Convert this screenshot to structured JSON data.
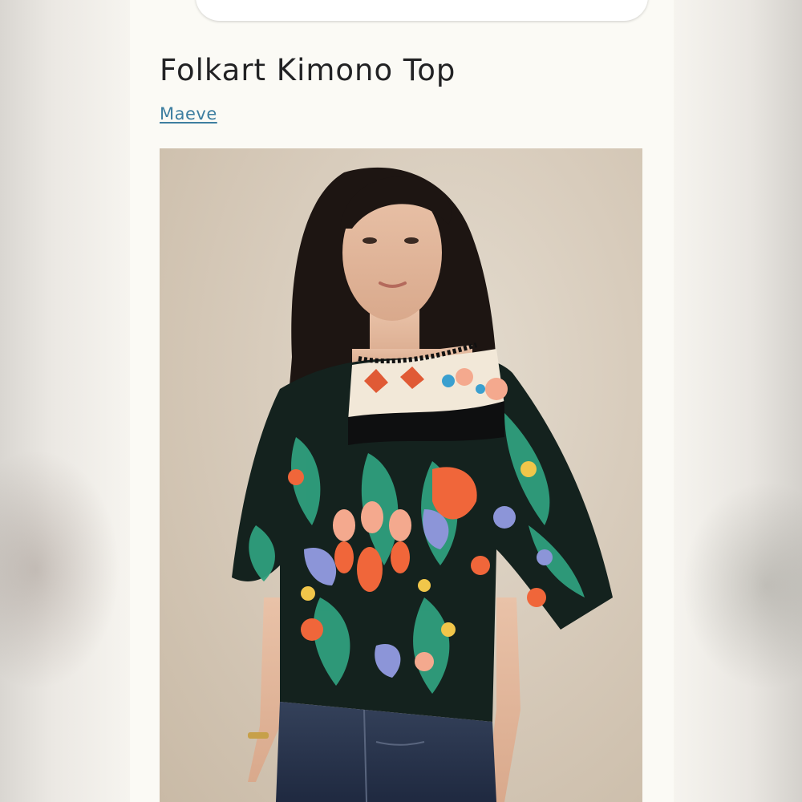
{
  "product": {
    "title": "Folkart Kimono Top",
    "brand": "Maeve"
  },
  "colors": {
    "brand_link": "#3d7ea0",
    "title_text": "#222224",
    "panel_background": "#fbfaf5"
  }
}
